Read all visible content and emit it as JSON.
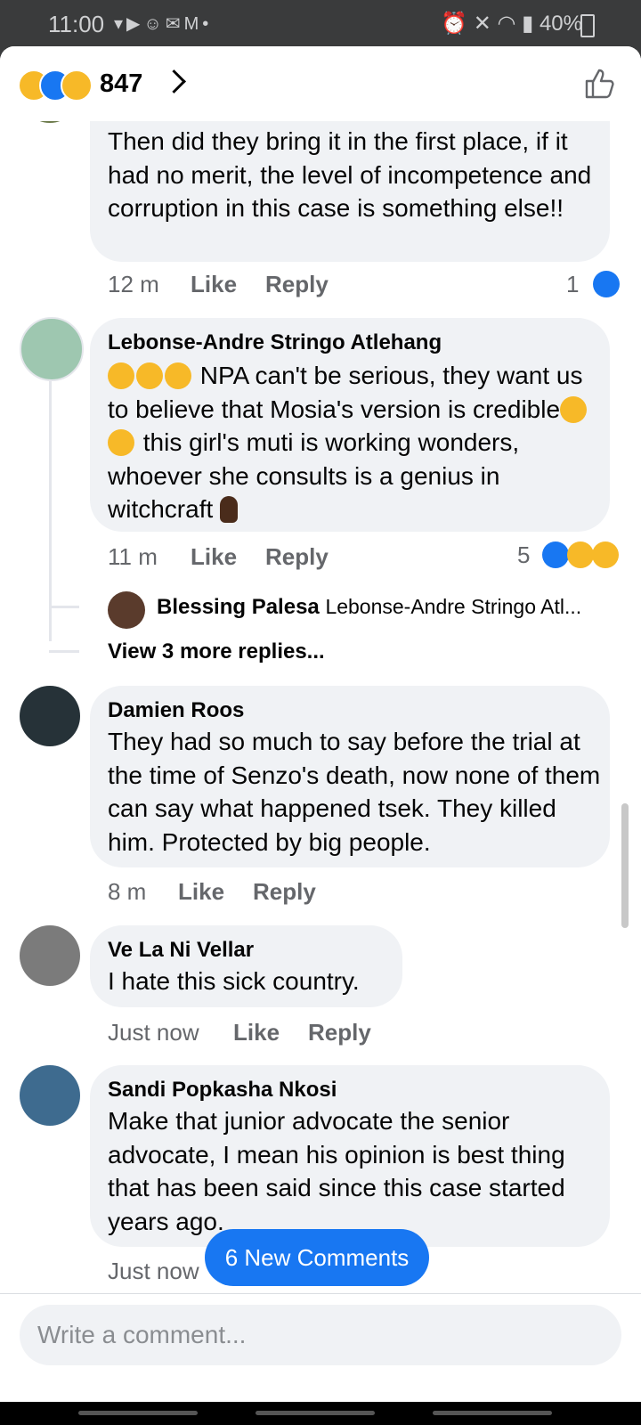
{
  "status_bar": {
    "time": "11:00",
    "battery": "40%"
  },
  "header": {
    "reaction_count": "847"
  },
  "comments": [
    {
      "text": "Then did they bring  it in the first place,  if it had no merit,  the level of incompetence and corruption  in this case is something  else!!",
      "time": "12 m",
      "like": "Like",
      "reply": "Reply",
      "reaction_count": "1"
    },
    {
      "author": "Lebonse-Andre Stringo Atlehang",
      "text_1": "NPA can't be serious,  they want us to believe that Mosia's version is credible",
      "text_2": " this girl's muti is working wonders,  whoever she consults is a genius in witchcraft ",
      "time": "11 m",
      "like": "Like",
      "reply": "Reply",
      "reaction_count": "5",
      "reply_preview": {
        "author": "Blessing Palesa",
        "text": "Lebonse-Andre Stringo Atl..."
      },
      "more_replies": "View 3 more replies..."
    },
    {
      "author": "Damien Roos",
      "text": "They had so much to say before the trial at the time of Senzo's death, now none of them can say what happened tsek. They killed him. Protected by big people.",
      "time": "8 m",
      "like": "Like",
      "reply": "Reply"
    },
    {
      "author": "Ve La Ni Vellar",
      "text": "I hate this sick country.",
      "time": "Just now",
      "like": "Like",
      "reply": "Reply"
    },
    {
      "author": "Sandi Popkasha Nkosi",
      "text": "Make that junior advocate the senior advocate, I mean his opinion is best thing that has been said since this case started years ago.",
      "time": "Just now"
    }
  ],
  "new_comments_button": "6 New Comments",
  "composer": {
    "placeholder": "Write a comment..."
  },
  "colors": {
    "accent": "#1877f2",
    "bubble": "#f0f2f5",
    "meta": "#65676b"
  }
}
